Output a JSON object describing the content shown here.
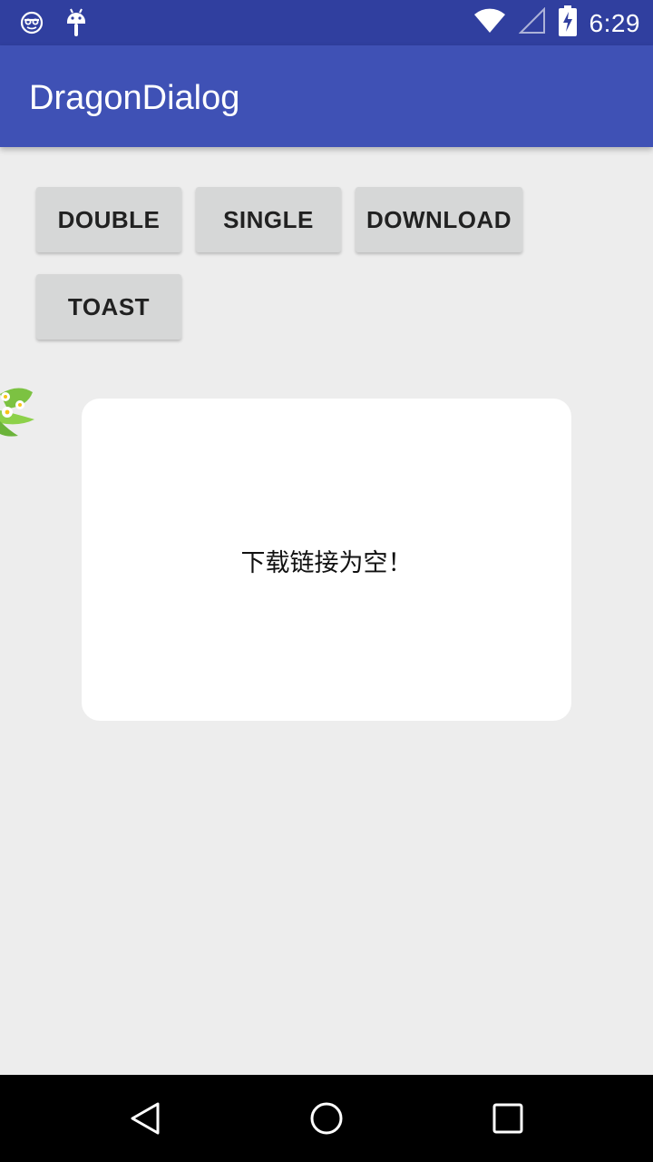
{
  "status_bar": {
    "time": "6:29",
    "icons": [
      "notification-face-icon",
      "android-debug-icon",
      "wifi-icon",
      "signal-icon",
      "battery-charging-icon"
    ]
  },
  "app_bar": {
    "title": "DragonDialog"
  },
  "buttons": {
    "double": "DOUBLE",
    "single": "SINGLE",
    "download": "DOWNLOAD",
    "toast": "TOAST"
  },
  "dialog": {
    "message": "下载链接为空！"
  },
  "nav_bar": {
    "icons": [
      "back-icon",
      "home-icon",
      "recents-icon"
    ]
  },
  "colors": {
    "status_bar": "#303F9F",
    "app_bar": "#3F51B5",
    "background": "#EDEDED",
    "button": "#D6D7D7"
  }
}
